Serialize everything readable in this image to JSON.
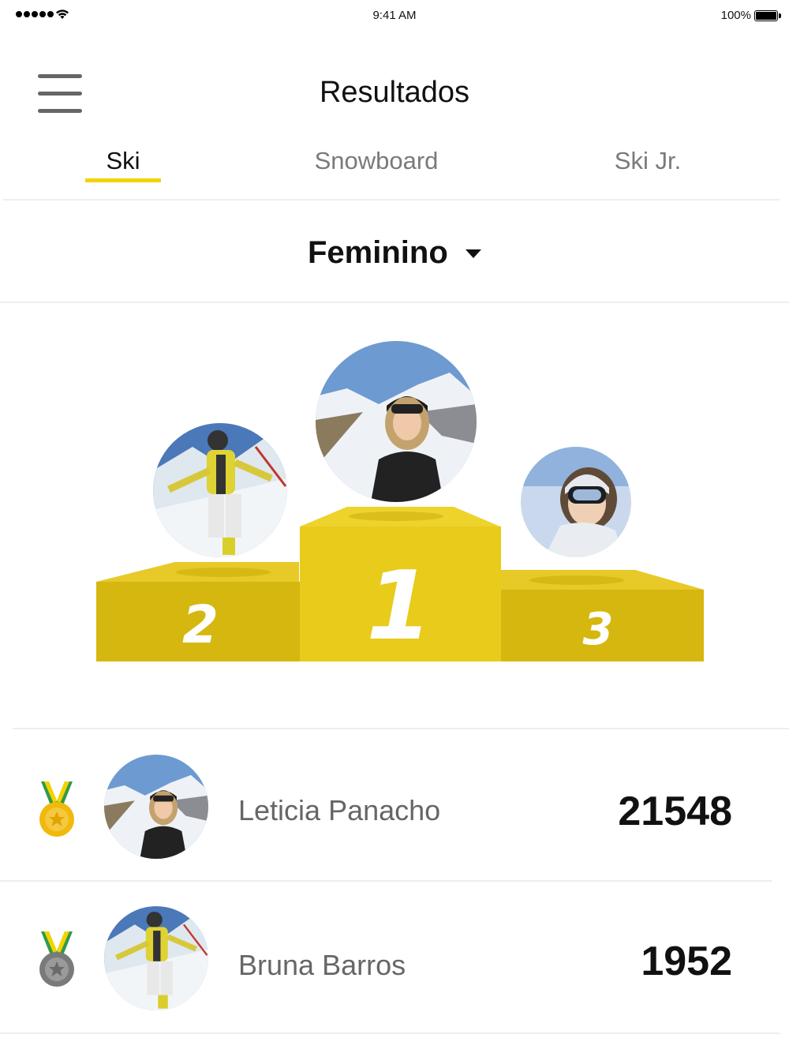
{
  "status_bar": {
    "time": "9:41 AM",
    "battery": "100%",
    "battery_level": 1.0
  },
  "header": {
    "title": "Resultados"
  },
  "tabs": [
    {
      "label": "Ski",
      "active": true
    },
    {
      "label": "Snowboard",
      "active": false
    },
    {
      "label": "Ski Jr.",
      "active": false
    }
  ],
  "category": {
    "selected": "Feminino"
  },
  "podium": {
    "places": [
      "1",
      "2",
      "3"
    ],
    "colors": {
      "center": "#e8cb1b",
      "center_top": "#edd32c",
      "side": "#d6b70f",
      "side_top": "#e7c928"
    }
  },
  "ranking": [
    {
      "name": "Leticia Panacho",
      "score": "21548",
      "medal": "gold-medal"
    },
    {
      "name": "Bruna Barros",
      "score": "1952",
      "medal": "silver-medal"
    }
  ],
  "colors": {
    "accent": "#f2d300",
    "text": "#111111",
    "muted": "#7a7a7a"
  }
}
